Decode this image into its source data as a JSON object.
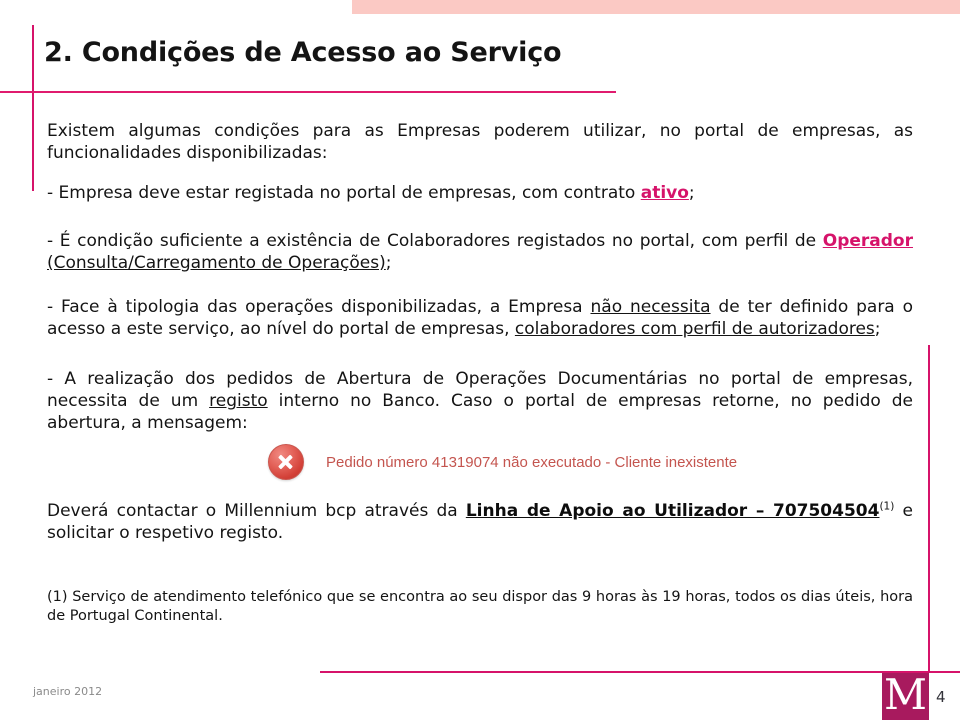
{
  "slide": {
    "title": "2. Condições de Acesso ao Serviço",
    "intro": {
      "before": "Existem algumas condições para as Empresas poderem utilizar, no portal de empresas, as funcionalidades disponibilizadas:"
    },
    "bullets": [
      {
        "id": "bullet-contrato-ativo",
        "segments": [
          {
            "text": "- Empresa deve estar registada no portal de empresas, com contrato ",
            "style": "plain"
          },
          {
            "text": "ativo",
            "style": "underline-pink"
          },
          {
            "text": ";",
            "style": "plain"
          }
        ]
      },
      {
        "id": "bullet-perfil-operador",
        "segments": [
          {
            "text": "- É condição suficiente a existência de Colaboradores registados no portal, com perfil de ",
            "style": "plain"
          },
          {
            "text": "Operador",
            "style": "underline-pink"
          },
          {
            "text": " ",
            "style": "plain"
          },
          {
            "text": "(Consulta/Carregamento de Operações)",
            "style": "underline-black"
          },
          {
            "text": ";",
            "style": "plain"
          }
        ]
      },
      {
        "id": "bullet-autorizadores",
        "segments": [
          {
            "text": "- Face à tipologia das operações disponibilizadas, a Empresa ",
            "style": "plain"
          },
          {
            "text": "não necessita",
            "style": "underline-black"
          },
          {
            "text": " de ter definido para o acesso a este serviço, ao nível do portal de empresas, ",
            "style": "plain"
          },
          {
            "text": "colaboradores com perfil de autorizadores",
            "style": "underline-black"
          },
          {
            "text": ";",
            "style": "plain"
          }
        ]
      },
      {
        "id": "bullet-registo-interno",
        "segments": [
          {
            "text": "- A realização dos pedidos de Abertura de Operações Documentárias no portal de empresas, necessita de um ",
            "style": "plain"
          },
          {
            "text": "registo",
            "style": "underline-black"
          },
          {
            "text": " interno no Banco. Caso o portal de empresas retorne, no pedido de abertura, a mensagem:",
            "style": "plain"
          }
        ]
      }
    ],
    "error_message": {
      "icon": "error-circle-x-icon",
      "text": "Pedido número 41319074 não executado - Cliente inexistente"
    },
    "closing": {
      "segments": [
        {
          "text": "Deverá contactar o Millennium bcp através da ",
          "style": "plain"
        },
        {
          "text": "Linha de Apoio ao Utilizador – 707504504",
          "style": "bold-underline-black"
        },
        {
          "text": "(1)",
          "style": "superscript"
        },
        {
          "text": " e solicitar o respetivo registo.",
          "style": "plain"
        }
      ]
    },
    "footnote": "(1) Serviço de atendimento telefónico que se encontra ao seu dispor das 9 horas às 19 horas, todos os dias úteis, hora de Portugal Continental.",
    "footer": {
      "date": "janeiro 2012",
      "logo_letter": "M",
      "page_number": "4"
    },
    "colors": {
      "accent_pink": "#d6136a",
      "band_pink": "#fbc9c4",
      "logo_magenta": "#a81a5e",
      "error_red": "#c4554f"
    }
  }
}
